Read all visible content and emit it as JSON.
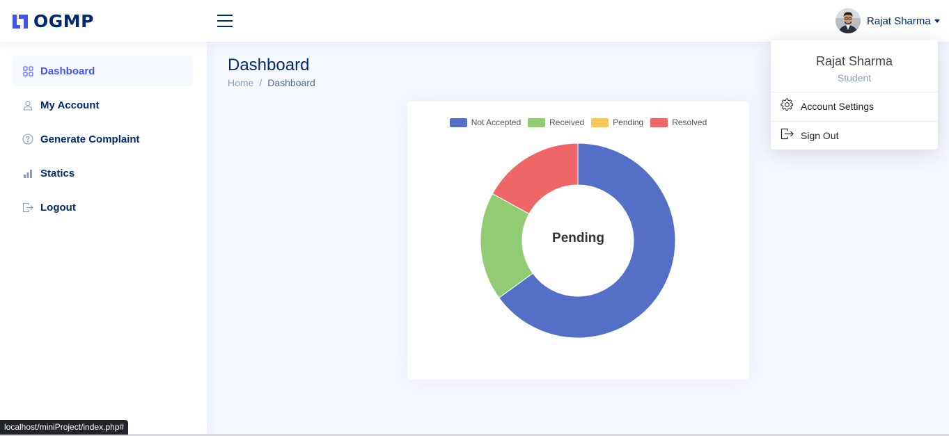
{
  "brand": {
    "name": "OGMP",
    "color": "#4154f1"
  },
  "header": {
    "menu_icon": "hamburger-icon",
    "user_name": "Rajat Sharma"
  },
  "sidebar": {
    "items": [
      {
        "label": "Dashboard",
        "icon": "grid-icon",
        "active": true
      },
      {
        "label": "My Account",
        "icon": "person-icon",
        "active": false
      },
      {
        "label": "Generate Complaint",
        "icon": "question-circle-icon",
        "active": false
      },
      {
        "label": "Statics",
        "icon": "bar-chart-icon",
        "active": false
      },
      {
        "label": "Logout",
        "icon": "box-arrow-right-icon",
        "active": false
      }
    ]
  },
  "main": {
    "title": "Dashboard",
    "breadcrumb": {
      "home": "Home",
      "separator": "/",
      "current": "Dashboard"
    }
  },
  "chart_data": {
    "type": "pie",
    "variant": "doughnut",
    "center_label": "Pending",
    "legend_position": "top",
    "categories": [
      "Not Accepted",
      "Received",
      "Pending",
      "Resolved"
    ],
    "values": [
      65,
      18,
      0,
      17
    ],
    "colors": [
      "#5470c6",
      "#91cc75",
      "#fac858",
      "#ee6666"
    ]
  },
  "profile_dropdown": {
    "name": "Rajat Sharma",
    "role": "Student",
    "items": [
      {
        "label": "Account Settings",
        "icon": "gear-icon"
      },
      {
        "label": "Sign Out",
        "icon": "box-arrow-right-icon"
      }
    ]
  },
  "statusbar": {
    "url": "localhost/miniProject/index.php#"
  }
}
